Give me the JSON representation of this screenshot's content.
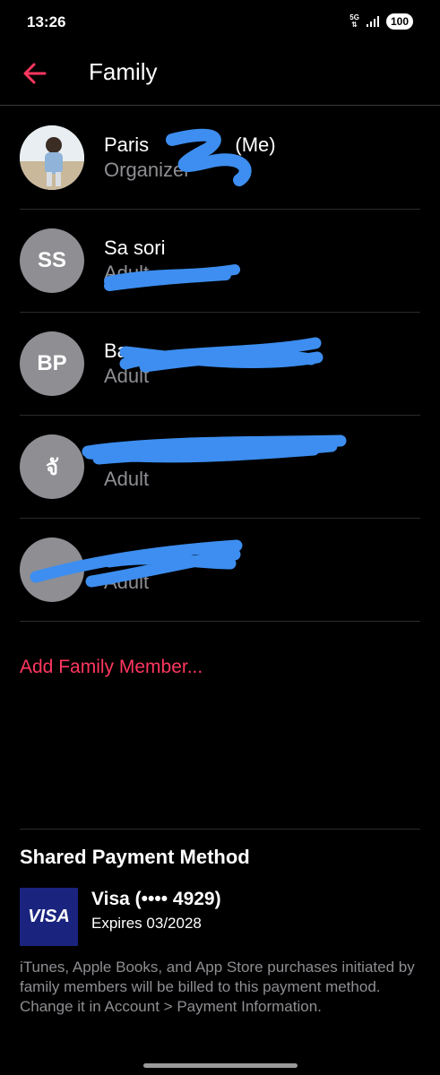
{
  "status_bar": {
    "time": "13:26",
    "network": "5G",
    "battery": "100"
  },
  "header": {
    "title": "Family"
  },
  "members": [
    {
      "initials": "",
      "name": "Paris",
      "name_suffix": "(Me)",
      "role": "Organizer",
      "has_photo": true
    },
    {
      "initials": "SS",
      "name": "Sa sori",
      "role": "Adult",
      "has_photo": false
    },
    {
      "initials": "BP",
      "name": "Ba",
      "role": "Adult",
      "has_photo": false
    },
    {
      "initials": "จั",
      "name": "",
      "role": "Adult",
      "has_photo": false
    },
    {
      "initials": "",
      "name": "",
      "role": "Adult",
      "has_photo": false
    }
  ],
  "add_member_label": "Add Family Member...",
  "payment": {
    "title": "Shared Payment Method",
    "card_brand": "VISA",
    "card_name": "Visa (•••• 4929)",
    "expiry": "Expires 03/2028",
    "note": "iTunes, Apple Books, and App Store purchases initiated by family members will be billed to this payment method. Change it in Account > Payment Information."
  },
  "colors": {
    "accent": "#ff375f",
    "background": "#000000",
    "secondary_text": "#8e8e93",
    "redaction": "#3d8ef0",
    "visa_blue": "#1a237e"
  }
}
